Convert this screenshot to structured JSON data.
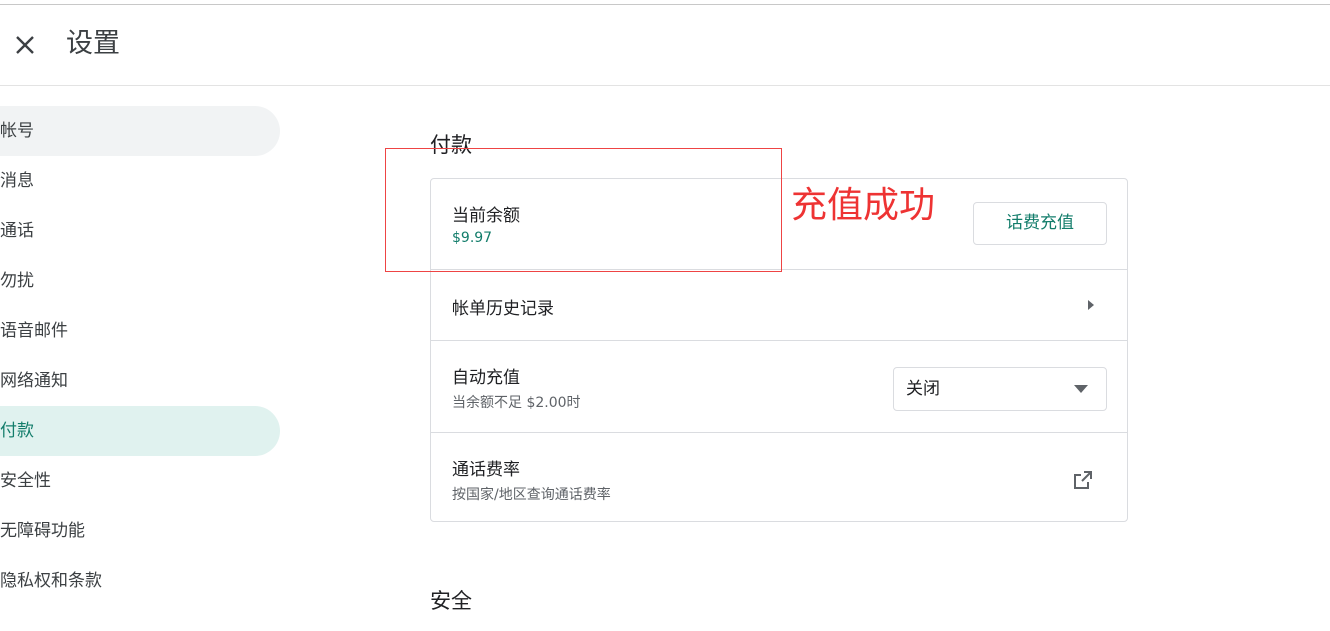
{
  "header": {
    "title": "设置"
  },
  "sidebar": {
    "items": [
      {
        "label": "帐号",
        "state": "hover"
      },
      {
        "label": "消息",
        "state": ""
      },
      {
        "label": "通话",
        "state": ""
      },
      {
        "label": "勿扰",
        "state": ""
      },
      {
        "label": "语音邮件",
        "state": ""
      },
      {
        "label": "网络通知",
        "state": ""
      },
      {
        "label": "付款",
        "state": "active"
      },
      {
        "label": "安全性",
        "state": ""
      },
      {
        "label": "无障碍功能",
        "state": ""
      },
      {
        "label": "隐私权和条款",
        "state": ""
      }
    ]
  },
  "payment": {
    "section_title": "付款",
    "balance": {
      "title": "当前余额",
      "value": "$9.97",
      "button": "话费充值"
    },
    "billing_history": {
      "title": "帐单历史记录"
    },
    "auto_recharge": {
      "title": "自动充值",
      "subtitle": "当余额不足 $2.00时",
      "selected": "关闭"
    },
    "call_rates": {
      "title": "通话费率",
      "subtitle": "按国家/地区查询通话费率"
    }
  },
  "security": {
    "section_title": "安全"
  },
  "annotation": {
    "text": "充值成功"
  },
  "colors": {
    "accent": "#137d6b",
    "active_bg": "#e0f2ef",
    "annotation": "#ee3333"
  }
}
